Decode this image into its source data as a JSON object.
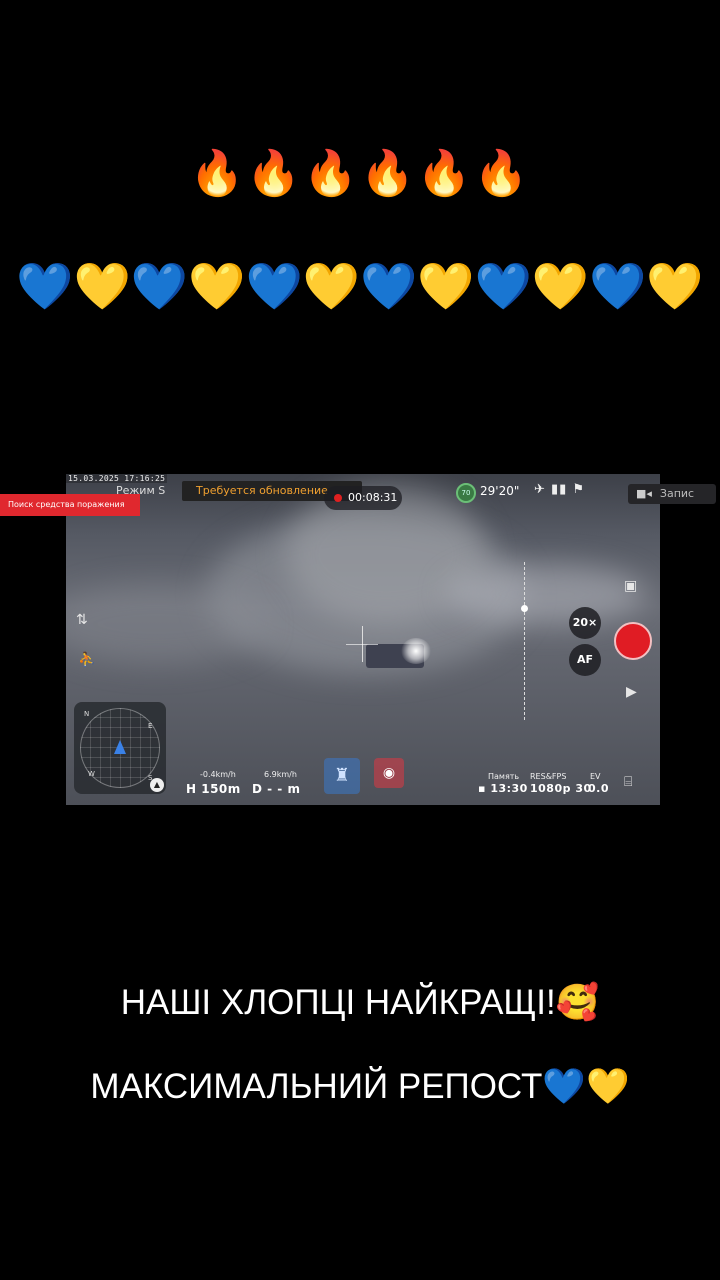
{
  "story": {
    "fire_emojis": "🔥🔥🔥🔥🔥🔥",
    "heart_emojis": "💙💛💙💛💙💛💙💛💙💛💙💛",
    "caption_line1": "НАШІ ХЛОПЦІ НАЙКРАЩІ!🥰",
    "caption_line2": "МАКСИМАЛЬНИЙ РЕПОСТ💙💛"
  },
  "overlay": {
    "search_label": "Поиск средства поражения",
    "record_label": "Запис"
  },
  "drone_hud": {
    "timestamp": "15.03.2025 17:16:25",
    "mode": "Режим S",
    "update_notice": "Требуется обновление",
    "rec_timer": "00:08:31",
    "battery": "70",
    "flight_time": "29'20\"",
    "zoom": "20×",
    "af": "AF",
    "minimap": {
      "n": "N",
      "e": "E",
      "s": "S",
      "w": "W"
    },
    "speed_v": "-0.4km/h",
    "speed_h": "6.9km/h",
    "height": "H 150m",
    "distance": "D - - m",
    "memory_label": "Память",
    "memory_value": "13:30",
    "resfps_label": "RES&FPS",
    "resfps_value": "1080p 30",
    "ev_label": "EV",
    "ev_value": "0.0"
  }
}
